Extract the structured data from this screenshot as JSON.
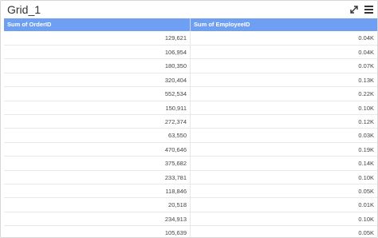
{
  "widget": {
    "title": "Grid_1"
  },
  "grid": {
    "columns": [
      "Sum of OrderID",
      "Sum of EmployeeID"
    ],
    "rows": [
      [
        "129,621",
        "0.04K"
      ],
      [
        "106,954",
        "0.04K"
      ],
      [
        "180,350",
        "0.07K"
      ],
      [
        "320,404",
        "0.13K"
      ],
      [
        "552,534",
        "0.22K"
      ],
      [
        "150,911",
        "0.10K"
      ],
      [
        "272,374",
        "0.12K"
      ],
      [
        "63,550",
        "0.03K"
      ],
      [
        "470,646",
        "0.19K"
      ],
      [
        "375,682",
        "0.14K"
      ],
      [
        "233,781",
        "0.10K"
      ],
      [
        "118,846",
        "0.05K"
      ],
      [
        "20,518",
        "0.01K"
      ],
      [
        "234,913",
        "0.10K"
      ],
      [
        "105,639",
        "0.05K"
      ]
    ]
  },
  "icons": {
    "expand": "expand-icon",
    "menu": "hamburger-menu-icon"
  }
}
